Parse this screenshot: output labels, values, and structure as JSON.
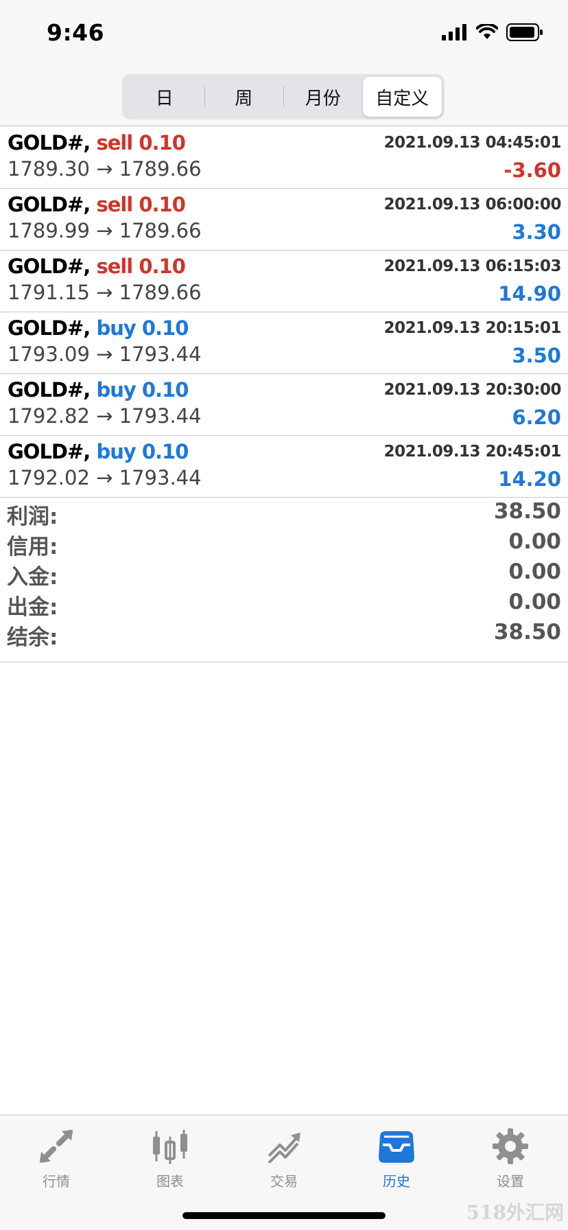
{
  "status": {
    "time": "9:46"
  },
  "period_tabs": [
    {
      "label": "日",
      "active": false
    },
    {
      "label": "周",
      "active": false
    },
    {
      "label": "月份",
      "active": false
    },
    {
      "label": "自定义",
      "active": true
    }
  ],
  "deals": [
    {
      "symbol": "GOLD#,",
      "side": "sell 0.10",
      "time": "2021.09.13 04:45:01",
      "prices": "1789.30 → 1789.66",
      "profit": "-3.60",
      "side_color": "red",
      "profit_color": "red"
    },
    {
      "symbol": "GOLD#,",
      "side": "sell 0.10",
      "time": "2021.09.13 06:00:00",
      "prices": "1789.99 → 1789.66",
      "profit": "3.30",
      "side_color": "red",
      "profit_color": "blue"
    },
    {
      "symbol": "GOLD#,",
      "side": "sell 0.10",
      "time": "2021.09.13 06:15:03",
      "prices": "1791.15 → 1789.66",
      "profit": "14.90",
      "side_color": "red",
      "profit_color": "blue"
    },
    {
      "symbol": "GOLD#,",
      "side": "buy 0.10",
      "time": "2021.09.13 20:15:01",
      "prices": "1793.09 → 1793.44",
      "profit": "3.50",
      "side_color": "blue",
      "profit_color": "blue"
    },
    {
      "symbol": "GOLD#,",
      "side": "buy 0.10",
      "time": "2021.09.13 20:30:00",
      "prices": "1792.82 → 1793.44",
      "profit": "6.20",
      "side_color": "blue",
      "profit_color": "blue"
    },
    {
      "symbol": "GOLD#,",
      "side": "buy 0.10",
      "time": "2021.09.13 20:45:01",
      "prices": "1792.02 → 1793.44",
      "profit": "14.20",
      "side_color": "blue",
      "profit_color": "blue"
    }
  ],
  "summary": [
    {
      "label": "利润:",
      "value": "38.50"
    },
    {
      "label": "信用:",
      "value": "0.00"
    },
    {
      "label": "入金:",
      "value": "0.00"
    },
    {
      "label": "出金:",
      "value": "0.00"
    },
    {
      "label": "结余:",
      "value": "38.50"
    }
  ],
  "tabbar": [
    {
      "label": "行情",
      "icon": "quotes-arrows-icon",
      "active": false
    },
    {
      "label": "图表",
      "icon": "candlestick-chart-icon",
      "active": false
    },
    {
      "label": "交易",
      "icon": "trade-trend-icon",
      "active": false
    },
    {
      "label": "历史",
      "icon": "history-inbox-icon",
      "active": true
    },
    {
      "label": "设置",
      "icon": "gear-icon",
      "active": false
    }
  ],
  "colors": {
    "red": "#d0342c",
    "blue": "#1e78d9",
    "inactive_tab": "#8e8e93"
  },
  "watermark": "518外汇网"
}
